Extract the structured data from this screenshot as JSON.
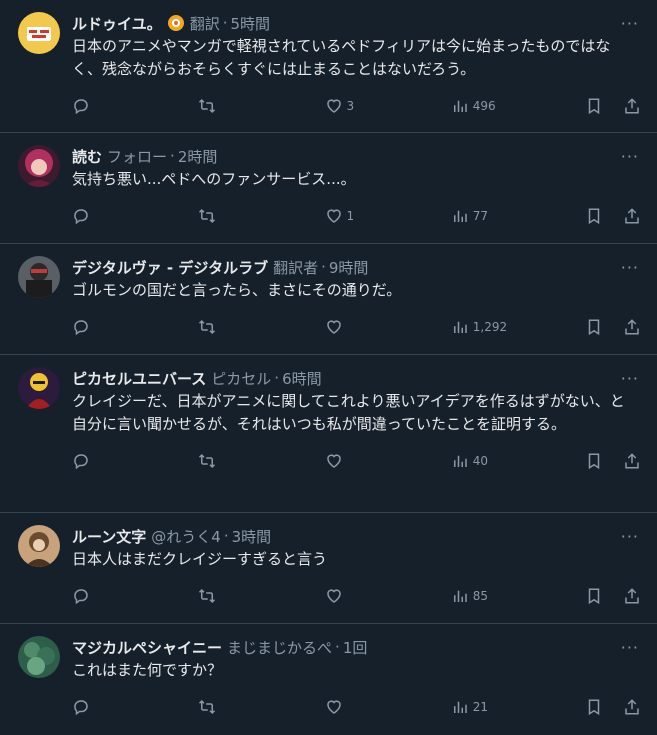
{
  "posts": [
    {
      "name": "ルドゥイユ。",
      "handle": "翻訳",
      "time": "5時間",
      "text": "日本のアニメやマンガで軽視されているペドフィリアは今に始まったものではなく、残念ながらおそらくすぐには止まることはないだろう。",
      "likes": "3",
      "views": "496"
    },
    {
      "name": "読む",
      "handle": "フォロー",
      "time": "2時間",
      "text": "気持ち悪い...ペドへのファンサービス...。",
      "likes": "1",
      "views": "77"
    },
    {
      "name": "デジタルヴァ - デジタルラブ",
      "handle": "翻訳者",
      "time": "9時間",
      "text": "ゴルモンの国だと言ったら、まさにその通りだ。",
      "likes": "",
      "views": "1,292"
    },
    {
      "name": "ピカセルユニバース",
      "handle": "ピカセル",
      "time": "6時間",
      "text": "クレイジーだ、日本がアニメに関してこれより悪いアイデアを作るはずがない、と自分に言い聞かせるが、それはいつも私が間違っていたことを証明する。",
      "likes": "",
      "views": "40"
    },
    {
      "name": "ルーン文字",
      "handle": "@れうく4",
      "time": "3時間",
      "text": "日本人はまだクレイジーすぎると言う",
      "likes": "",
      "views": "85"
    },
    {
      "name": "マジカルペシャイニー",
      "handle": "まじまじかるぺ",
      "time": "1回",
      "text": "これはまた何ですか？",
      "likes": "",
      "views": "21"
    }
  ],
  "more_glyph": "···",
  "separator": "·",
  "colors": {
    "background": "#15202b",
    "text": "#e7e9ea",
    "muted": "#8b98a5",
    "divider": "#38444d",
    "badge": "#f4a623"
  }
}
